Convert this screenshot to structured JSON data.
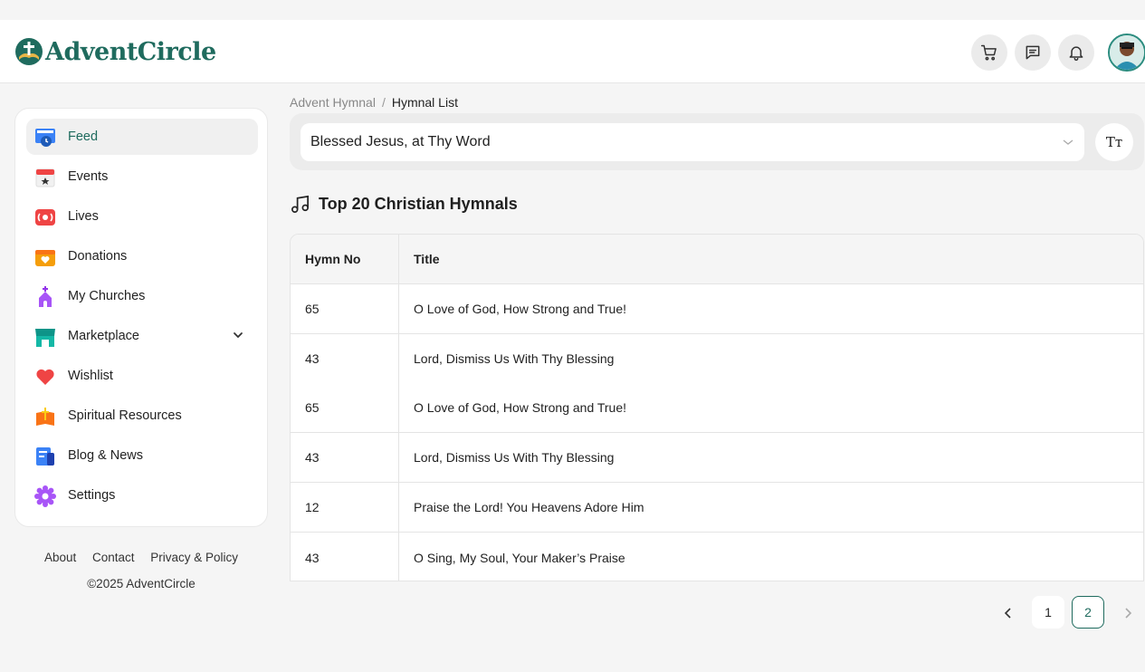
{
  "brand": {
    "name": "AdventCircle",
    "accent": "#1f6b5e"
  },
  "header": {
    "buttons": [
      {
        "name": "cart-button",
        "icon": "cart-icon"
      },
      {
        "name": "messages-button",
        "icon": "chat-icon"
      },
      {
        "name": "notifications-button",
        "icon": "bell-icon"
      }
    ]
  },
  "sidebar": {
    "items": [
      {
        "label": "Feed",
        "icon": "feed-icon",
        "active": true
      },
      {
        "label": "Events",
        "icon": "calendar-icon"
      },
      {
        "label": "Lives",
        "icon": "live-icon"
      },
      {
        "label": "Donations",
        "icon": "donation-box-icon"
      },
      {
        "label": "My Churches",
        "icon": "church-icon"
      },
      {
        "label": "Marketplace",
        "icon": "store-icon",
        "expandable": true
      },
      {
        "label": "Wishlist",
        "icon": "heart-icon"
      },
      {
        "label": "Spiritual Resources",
        "icon": "bible-icon"
      },
      {
        "label": "Blog & News",
        "icon": "news-icon"
      },
      {
        "label": "Settings",
        "icon": "gear-icon"
      }
    ]
  },
  "footer": {
    "links": [
      "About",
      "Contact",
      "Privacy & Policy"
    ],
    "copyright": "©2025 AdventCircle"
  },
  "breadcrumb": {
    "parent": "Advent Hymnal",
    "separator": "/",
    "current": "Hymnal List"
  },
  "hymn_select": {
    "value": "Blessed Jesus, at Thy Word"
  },
  "font_button": {
    "label": "Tт",
    "icon": "text-size-icon"
  },
  "section": {
    "title": "Top 20 Christian Hymnals",
    "icon": "music-note-icon"
  },
  "table": {
    "headers": [
      "Hymn No",
      "Title"
    ],
    "rows": [
      {
        "no": "65",
        "title": "O Love of God, How Strong and True!"
      },
      {
        "no": "43",
        "title": "Lord, Dismiss Us With Thy Blessing"
      },
      {
        "no": "65",
        "title": "O Love of God, How Strong and True!"
      },
      {
        "no": "43",
        "title": "Lord, Dismiss Us With Thy Blessing"
      },
      {
        "no": "12",
        "title": "Praise the Lord! You Heavens Adore Him"
      },
      {
        "no": "43",
        "title": "O Sing, My Soul, Your Maker’s Praise"
      }
    ]
  },
  "pagination": {
    "pages": [
      "1",
      "2"
    ],
    "current": "2"
  }
}
